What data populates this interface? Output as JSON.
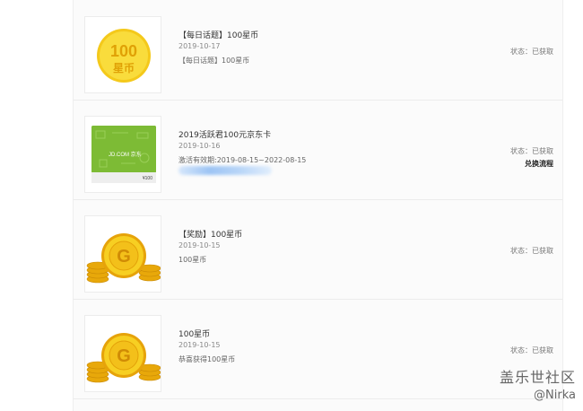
{
  "records": [
    {
      "title": "【每日话题】100星币",
      "date": "2019-10-17",
      "desc": "【每日话题】100星币",
      "status": "状态：已获取",
      "coin_text": "100",
      "coin_unit": "星币"
    },
    {
      "title": "2019活跃君100元京东卡",
      "date": "2019-10-16",
      "desc": "激活有效期:2019-08-15~2022-08-15",
      "status": "状态：已获取",
      "action": "兑换流程",
      "card_brand": "JD.COM 京东",
      "card_value": "¥100"
    },
    {
      "title": "【奖励】100星币",
      "date": "2019-10-15",
      "desc": "100星币",
      "status": "状态：已获取",
      "coin_letter": "G"
    },
    {
      "title": "100星币",
      "date": "2019-10-15",
      "desc": "恭喜获得100星币",
      "status": "状态：已获取",
      "coin_letter": "G"
    }
  ],
  "watermark": {
    "line1": "盖乐世社区",
    "line2": "@Nirka"
  },
  "colors": {
    "coin_gold": "#f4c91b",
    "coin_text": "#e0a106",
    "card_green": "#8cc63f"
  }
}
